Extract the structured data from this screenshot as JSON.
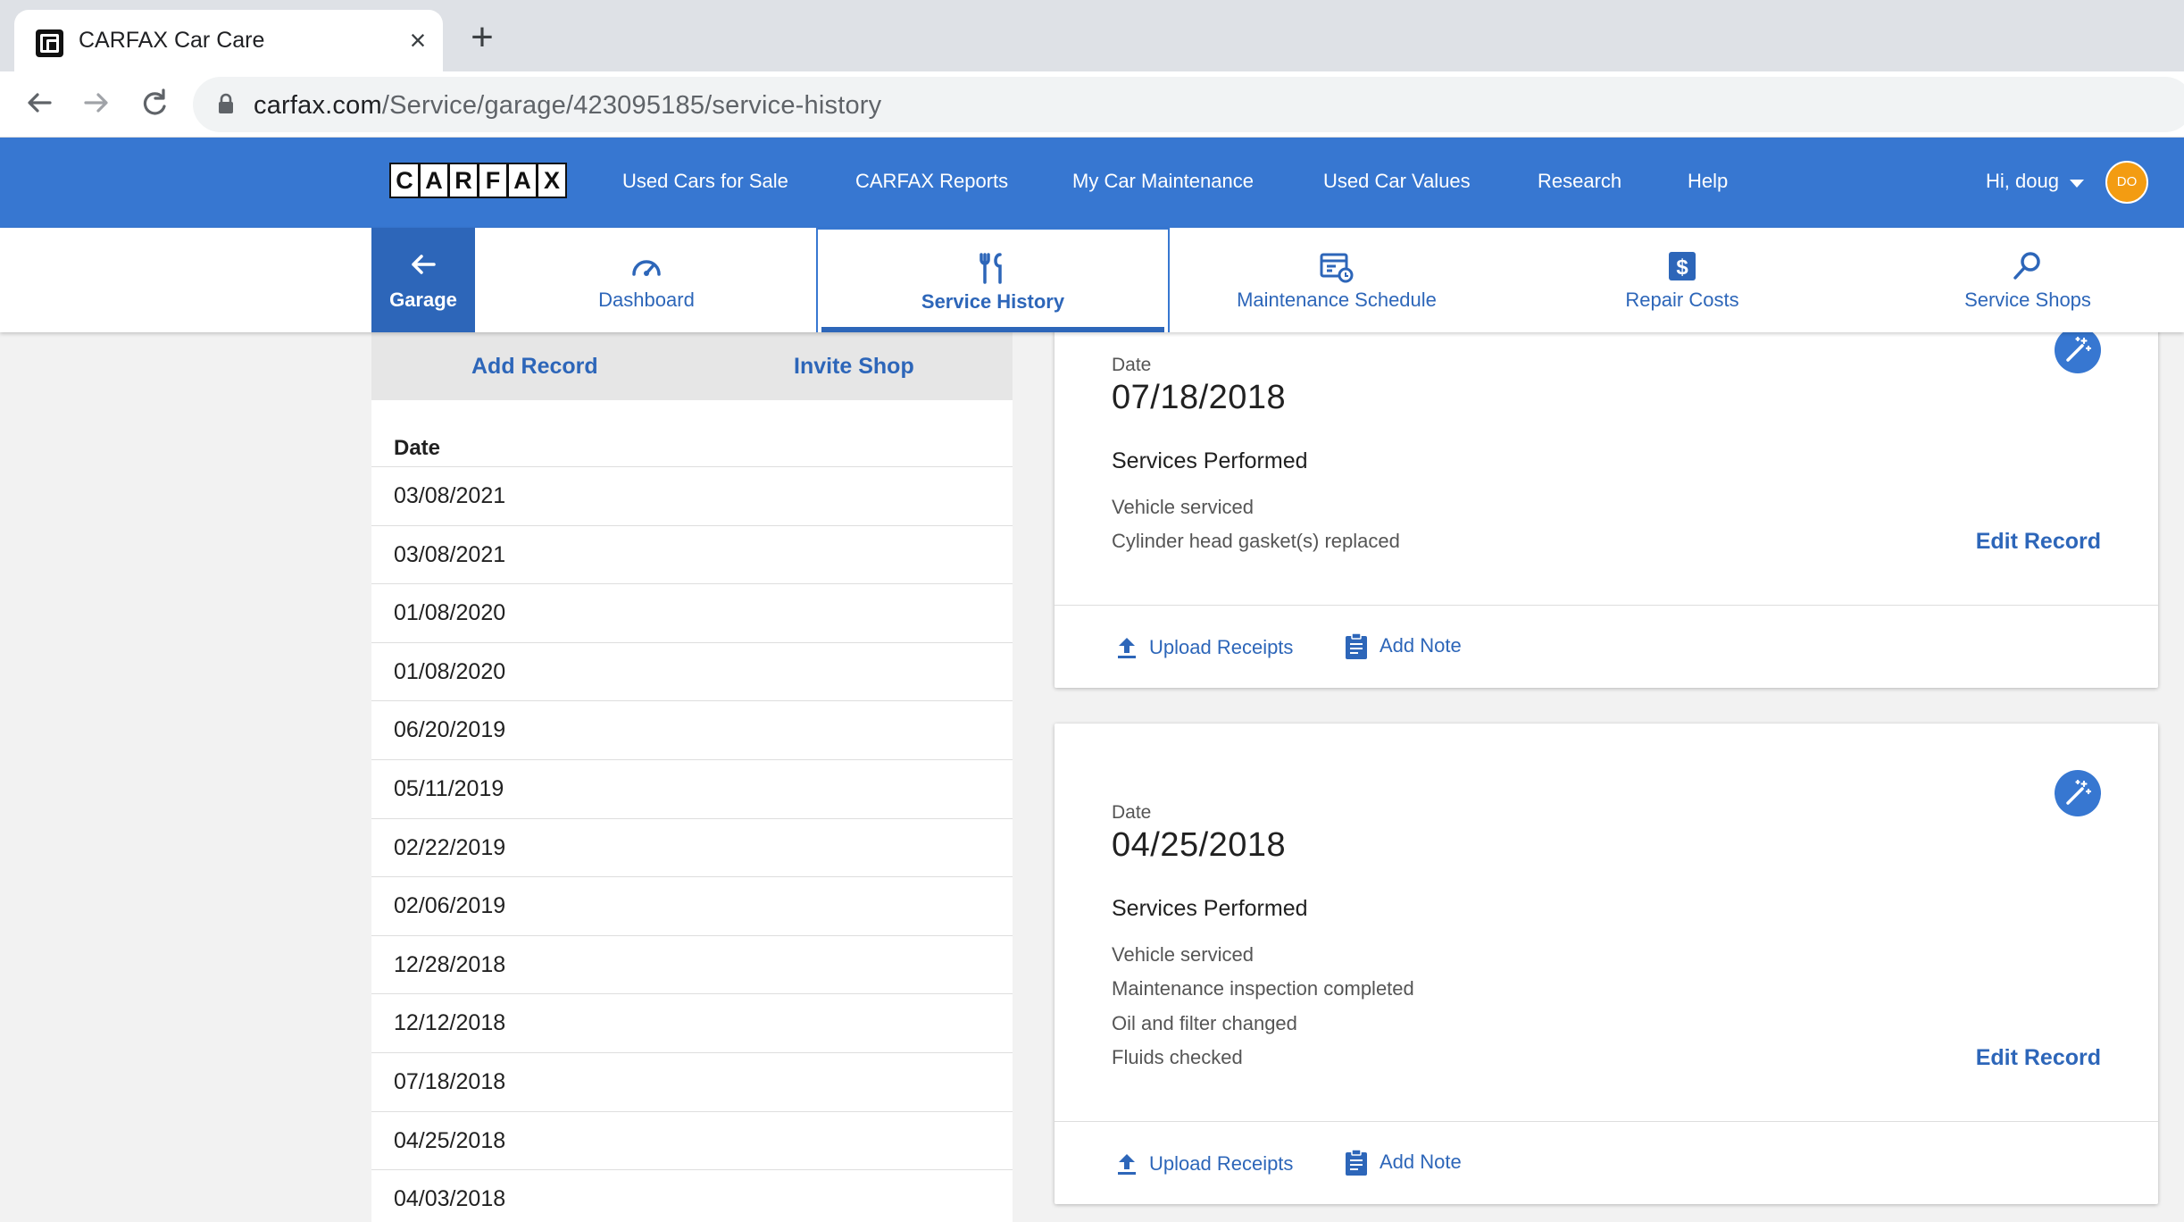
{
  "browser": {
    "tab_title": "CARFAX Car Care",
    "close_glyph": "×",
    "newtab_glyph": "+",
    "url_host": "carfax.com",
    "url_path": "/Service/garage/423095185/service-history"
  },
  "header": {
    "logo_letters": [
      "C",
      "A",
      "R",
      "F",
      "A",
      "X"
    ],
    "nav": [
      "Used Cars for Sale",
      "CARFAX Reports",
      "My Car Maintenance",
      "Used Car Values",
      "Research",
      "Help"
    ],
    "greeting": "Hi, doug",
    "avatar_initials": "DO",
    "brand_color": "#3777d1",
    "avatar_color": "#f39c12"
  },
  "subnav": {
    "garage": "Garage",
    "tabs": [
      {
        "label": "Dashboard",
        "icon": "speedometer-icon"
      },
      {
        "label": "Service History",
        "icon": "tools-icon"
      },
      {
        "label": "Maintenance Schedule",
        "icon": "calendar-clock-icon"
      },
      {
        "label": "Repair Costs",
        "icon": "dollar-icon"
      },
      {
        "label": "Service Shops",
        "icon": "search-icon"
      }
    ],
    "active": "Service History"
  },
  "left": {
    "add_record": "Add Record",
    "invite_shop": "Invite Shop",
    "date_header": "Date",
    "dates": [
      "03/08/2021",
      "03/08/2021",
      "01/08/2020",
      "01/08/2020",
      "06/20/2019",
      "05/11/2019",
      "02/22/2019",
      "02/06/2019",
      "12/28/2018",
      "12/12/2018",
      "07/18/2018",
      "04/25/2018",
      "04/03/2018"
    ]
  },
  "records": [
    {
      "date_label": "Date",
      "date": "07/18/2018",
      "services_label": "Services Performed",
      "services": [
        "Vehicle serviced",
        "Cylinder head gasket(s) replaced"
      ],
      "edit": "Edit Record",
      "upload": "Upload Receipts",
      "note": "Add Note"
    },
    {
      "date_label": "Date",
      "date": "04/25/2018",
      "services_label": "Services Performed",
      "services": [
        "Vehicle serviced",
        "Maintenance inspection completed",
        "Oil and filter changed",
        "Fluids checked"
      ],
      "edit": "Edit Record",
      "upload": "Upload Receipts",
      "note": "Add Note"
    }
  ]
}
